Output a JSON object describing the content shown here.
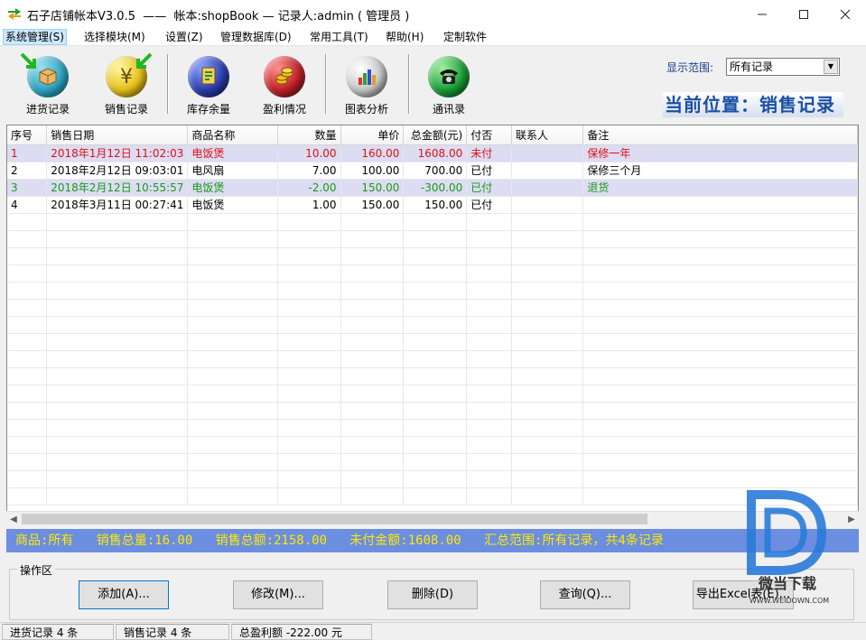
{
  "window": {
    "title": "石子店铺帐本V3.0.5  ——  帐本:shopBook — 记录人:admin ( 管理员 )",
    "controls": [
      "—",
      "☐",
      "✕"
    ]
  },
  "menu": [
    {
      "label": "系统管理(S)"
    },
    {
      "label": "选择模块(M)"
    },
    {
      "label": "设置(Z)"
    },
    {
      "label": "管理数据库(D)"
    },
    {
      "label": "常用工具(T)"
    },
    {
      "label": "帮助(H)"
    },
    {
      "label": "定制软件"
    }
  ],
  "toolbar": [
    {
      "label": "进货记录",
      "icon": "box-import-icon",
      "color": "#2ea6c4"
    },
    {
      "label": "销售记录",
      "icon": "yen-coin-icon",
      "color": "#e8c21a"
    },
    {
      "label": "库存余量",
      "icon": "stock-book-icon",
      "color": "#2a3fb0"
    },
    {
      "label": "盈利情况",
      "icon": "coins-icon",
      "color": "#c4202a"
    },
    {
      "label": "图表分析",
      "icon": "bar-chart-icon",
      "color": "#b8b8b8"
    },
    {
      "label": "通讯录",
      "icon": "telephone-icon",
      "color": "#1aa03a"
    }
  ],
  "range": {
    "label": "显示范围:",
    "value": "所有记录"
  },
  "position": "当前位置：销售记录",
  "table": {
    "columns": [
      "序号",
      "销售日期",
      "商品名称",
      "数量",
      "单价",
      "总金额(元)",
      "付否",
      "联系人",
      "备注"
    ],
    "rows": [
      {
        "cells": [
          "1",
          "2018年1月12日 11:02:03",
          "电饭煲",
          "10.00",
          "160.00",
          "1608.00",
          "未付",
          "",
          "保修一年"
        ],
        "style": "red"
      },
      {
        "cells": [
          "2",
          "2018年2月12日 09:03:01",
          "电风扇",
          "7.00",
          "100.00",
          "700.00",
          "已付",
          "",
          "保修三个月"
        ],
        "style": "normal"
      },
      {
        "cells": [
          "3",
          "2018年2月12日 10:55:57",
          "电饭煲",
          "-2.00",
          "150.00",
          "-300.00",
          "已付",
          "",
          "退货"
        ],
        "style": "green"
      },
      {
        "cells": [
          "4",
          "2018年3月11日 00:27:41",
          "电饭煲",
          "1.00",
          "150.00",
          "150.00",
          "已付",
          "",
          ""
        ],
        "style": "normal"
      }
    ]
  },
  "summary": "商品:所有   销售总量:16.00   销售总额:2158.00   未付金额:1608.00   汇总范围:所有记录，共4条记录",
  "operations": {
    "legend": "操作区",
    "buttons": [
      "添加(A)...",
      "修改(M)...",
      "删除(D)",
      "查询(Q)...",
      "导出Excel表(E)..."
    ]
  },
  "status": [
    "进货记录 4 条",
    "销售记录 4 条",
    "总盈利额 -222.00 元"
  ],
  "watermark": {
    "text": "微当下载",
    "url": "WWW.WEIDOWN.COM"
  }
}
